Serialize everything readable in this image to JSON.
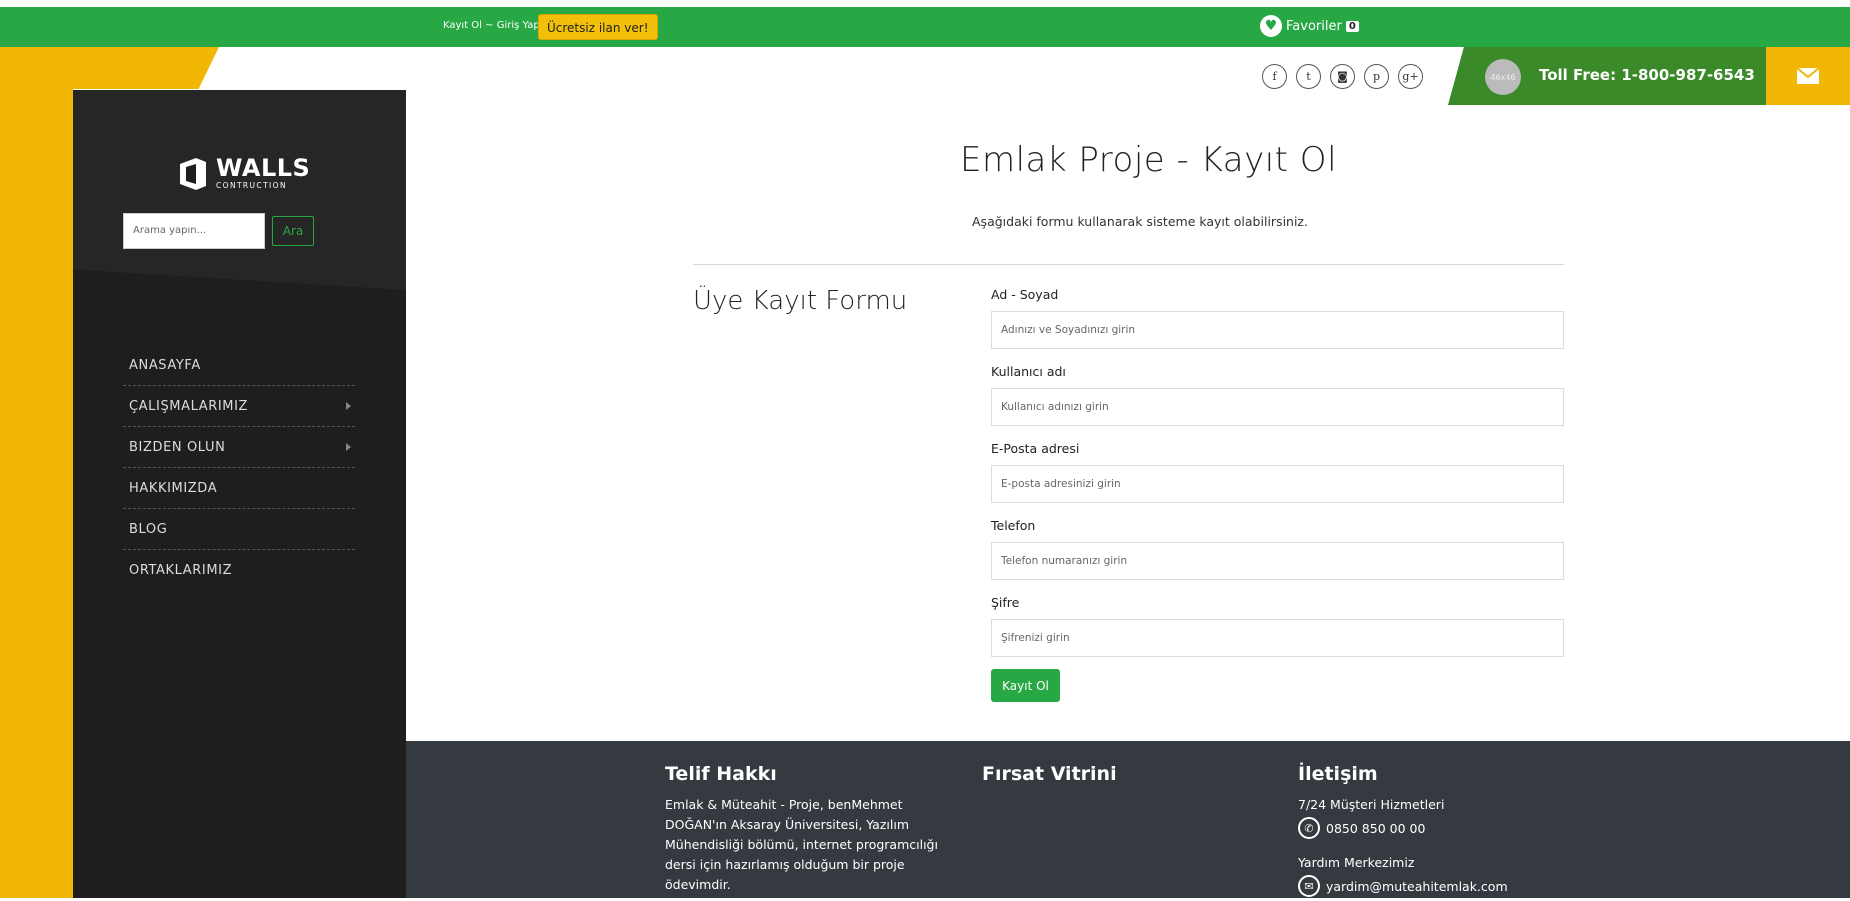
{
  "topbar": {
    "register": "Kayıt Ol",
    "separator": "~",
    "login": "Giriş Yap",
    "free_ad": "Ücretsiz ilan ver!",
    "favorites_label": "Favoriler",
    "favorites_count": "0"
  },
  "socials": [
    {
      "icon": "facebook-icon",
      "glyph": "f"
    },
    {
      "icon": "twitter-icon",
      "glyph": "t"
    },
    {
      "icon": "instagram-icon",
      "glyph": "◙"
    },
    {
      "icon": "pinterest-icon",
      "glyph": "p"
    },
    {
      "icon": "google-plus-icon",
      "glyph": "g+"
    }
  ],
  "header": {
    "avatar_text": "46x46",
    "toll_free": "Toll Free: 1-800-987-6543"
  },
  "sidebar": {
    "logo_main": "WALLS",
    "logo_sub": "CONTRUCTION",
    "search_placeholder": "Arama yapın...",
    "search_button": "Ara",
    "nav": [
      {
        "label": "ANASAYFA",
        "has_arrow": false
      },
      {
        "label": "ÇALIŞMALARIMIZ",
        "has_arrow": true
      },
      {
        "label": "BIZDEN OLUN",
        "has_arrow": true
      },
      {
        "label": "HAKKIMIZDA",
        "has_arrow": false
      },
      {
        "label": "BLOG",
        "has_arrow": false
      },
      {
        "label": "ORTAKLARIMIZ",
        "has_arrow": false
      }
    ]
  },
  "main": {
    "title": "Emlak Proje - Kayıt Ol",
    "subtitle": "Aşağıdaki formu kullanarak sisteme kayıt olabilirsiniz.",
    "form_heading": "Üye Kayıt Formu",
    "fields": [
      {
        "label": "Ad - Soyad",
        "placeholder": "Adınızı ve Soyadınızı girin"
      },
      {
        "label": "Kullanıcı adı",
        "placeholder": "Kullanıcı adınızı girin"
      },
      {
        "label": "E-Posta adresi",
        "placeholder": "E-posta adresinizi girin"
      },
      {
        "label": "Telefon",
        "placeholder": "Telefon numaranızı girin"
      },
      {
        "label": "Şifre",
        "placeholder": "Şifrenizi girin"
      }
    ],
    "submit": "Kayıt Ol"
  },
  "footer": {
    "copyright_title": "Telif Hakkı",
    "copyright_text": "Emlak & Müteahit - Proje, benMehmet DOĞAN'ın Aksaray Üniversitesi, Yazılım Mühendisliği bölümü, internet programcılığı dersi için hazırlamış olduğum bir proje ödevimdir.",
    "showcase_title": "Fırsat Vitrini",
    "contact_title": "İletişim",
    "support_label": "7/24 Müşteri Hizmetleri",
    "phone": "0850 850 00 00",
    "help_label": "Yardım Merkezimiz",
    "email": "yardim@muteahitemlak.com"
  },
  "colors": {
    "green": "#28a745",
    "yellow": "#f2b705",
    "sidebar": "#1e1e1e",
    "footer": "#343a40"
  }
}
